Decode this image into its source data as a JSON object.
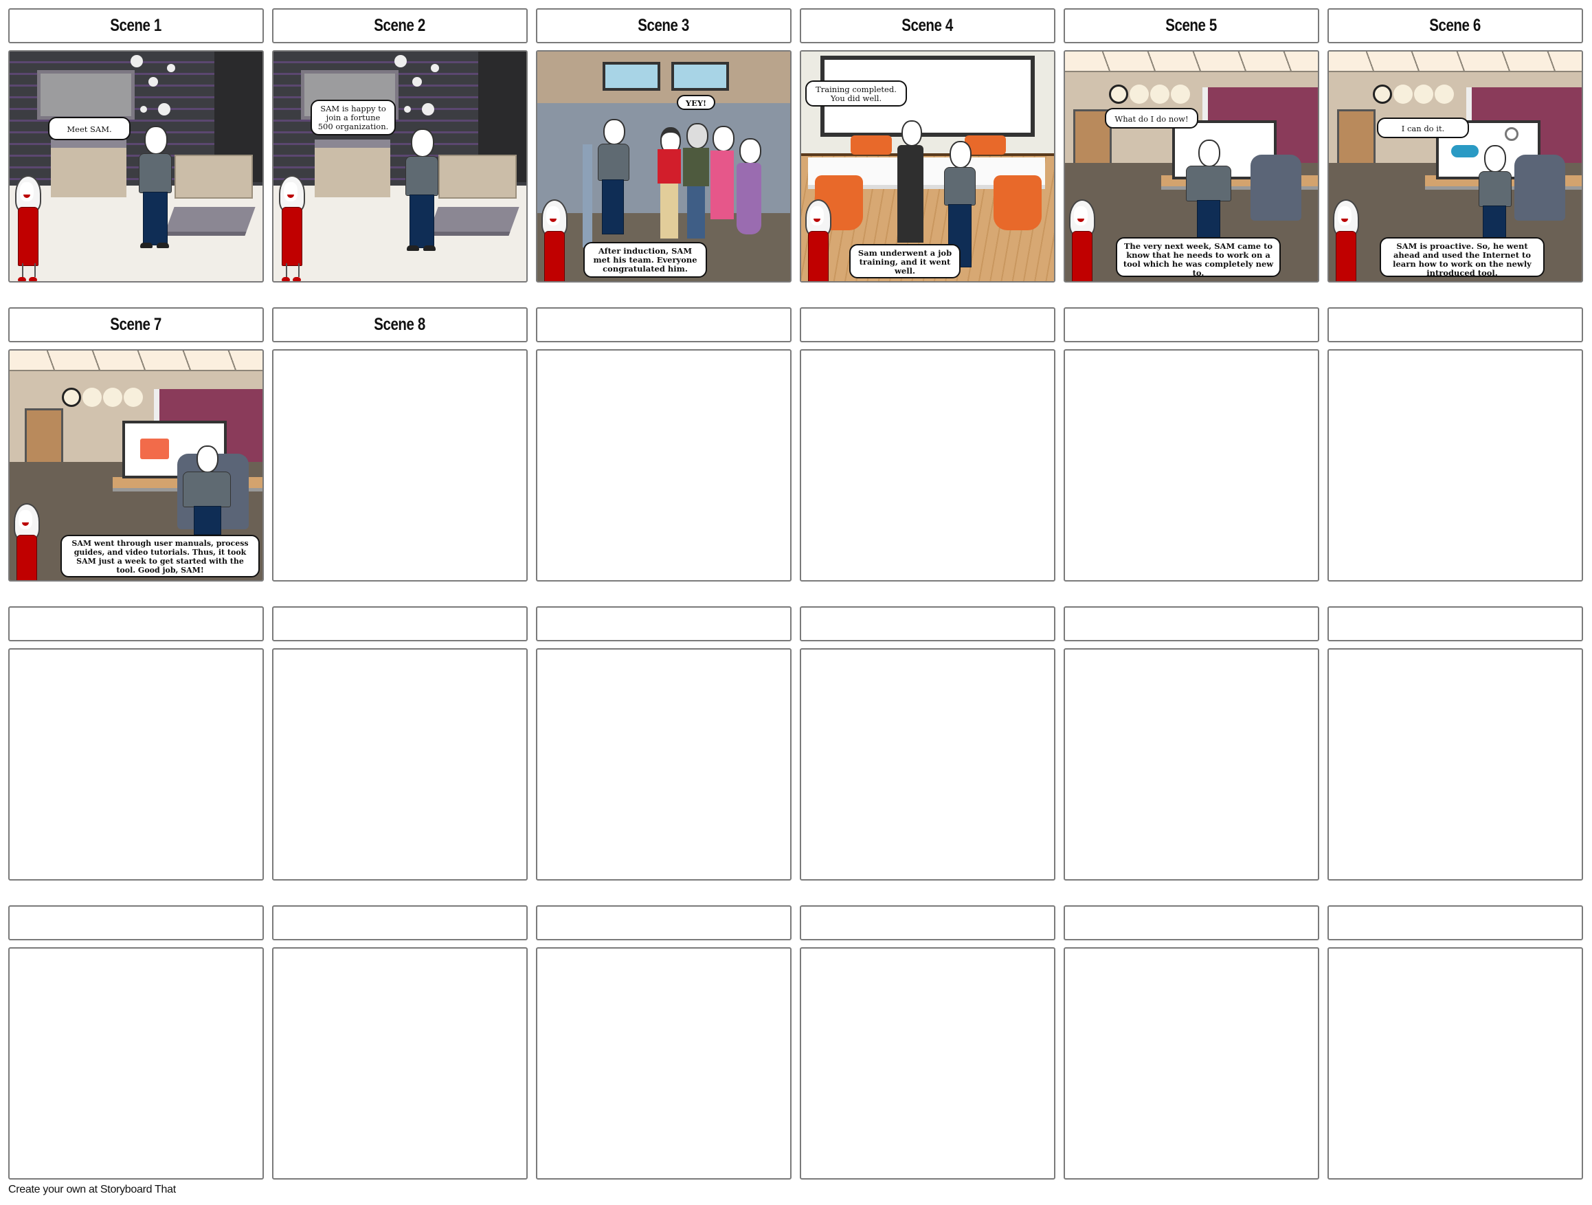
{
  "storyboard": {
    "rows": [
      [
        {
          "title": "Scene 1",
          "scene": "lounge",
          "bubbles": [
            {
              "text": "Meet SAM.",
              "speaker": "narrator"
            }
          ]
        },
        {
          "title": "Scene 2",
          "scene": "lounge",
          "bubbles": [
            {
              "text": "SAM is happy to join a fortune 500 organization.",
              "speaker": "narrator"
            }
          ]
        },
        {
          "title": "Scene 3",
          "scene": "cubicles",
          "bubbles": [
            {
              "text": "YEY!",
              "speaker": "team"
            },
            {
              "text": "After induction, SAM met his team. Everyone congratulated him.",
              "speaker": "narrator"
            }
          ]
        },
        {
          "title": "Scene 4",
          "scene": "training-room",
          "bubbles": [
            {
              "text": "Training completed. You did well.",
              "speaker": "trainer"
            },
            {
              "text": "Sam underwent a job training, and it went well.",
              "speaker": "narrator"
            }
          ]
        },
        {
          "title": "Scene 5",
          "scene": "office",
          "bubbles": [
            {
              "text": "What do I do now!",
              "speaker": "sam"
            },
            {
              "text": "The very next week, SAM came to know that he needs to work on a tool which he was completely new to.",
              "speaker": "narrator"
            }
          ]
        },
        {
          "title": "Scene 6",
          "scene": "office",
          "bubbles": [
            {
              "text": "I can do it.",
              "speaker": "sam"
            },
            {
              "text": "SAM is proactive. So, he went ahead and used the Internet to learn how to work on the newly introduced tool.",
              "speaker": "narrator"
            }
          ]
        }
      ],
      [
        {
          "title": "Scene 7",
          "scene": "office",
          "bubbles": [
            {
              "text": "SAM went through user manuals, process guides, and video tutorials. Thus, it took SAM just a week to get started with the tool. Good job, SAM!",
              "speaker": "narrator"
            }
          ]
        },
        {
          "title": "Scene 8",
          "scene": "empty",
          "bubbles": []
        },
        {
          "title": "",
          "scene": "empty",
          "bubbles": []
        },
        {
          "title": "",
          "scene": "empty",
          "bubbles": []
        },
        {
          "title": "",
          "scene": "empty",
          "bubbles": []
        },
        {
          "title": "",
          "scene": "empty",
          "bubbles": []
        }
      ],
      [
        {
          "title": "",
          "scene": "empty",
          "bubbles": []
        },
        {
          "title": "",
          "scene": "empty",
          "bubbles": []
        },
        {
          "title": "",
          "scene": "empty",
          "bubbles": []
        },
        {
          "title": "",
          "scene": "empty",
          "bubbles": []
        },
        {
          "title": "",
          "scene": "empty",
          "bubbles": []
        },
        {
          "title": "",
          "scene": "empty",
          "bubbles": []
        }
      ],
      [
        {
          "title": "",
          "scene": "empty",
          "bubbles": []
        },
        {
          "title": "",
          "scene": "empty",
          "bubbles": []
        },
        {
          "title": "",
          "scene": "empty",
          "bubbles": []
        },
        {
          "title": "",
          "scene": "empty",
          "bubbles": []
        },
        {
          "title": "",
          "scene": "empty",
          "bubbles": []
        },
        {
          "title": "",
          "scene": "empty",
          "bubbles": []
        }
      ]
    ]
  },
  "footer": {
    "text": "Create your own at Storyboard That"
  },
  "colors": {
    "border": "#7a7a7a",
    "narrator_dress": "#c00000",
    "sam_sweater": "#5f6a72",
    "sam_jeans": "#0f2d55",
    "office_wall": "#d1c2ae",
    "office_partition": "#8a3b5a",
    "lounge_wall": "#3c3d42",
    "training_chair": "#e8692a",
    "cloud": "#2a9ac4",
    "folder": "#f26b4a"
  },
  "scene_icons": {
    "scene6_screen": [
      "cloud-icon",
      "magnifier-icon"
    ],
    "scene7_screen": [
      "folder-icon"
    ]
  }
}
